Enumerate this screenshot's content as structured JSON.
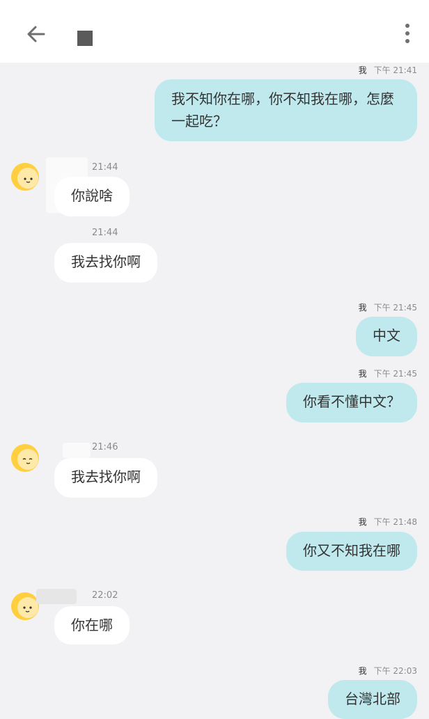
{
  "header": {
    "back_icon": "arrow-left-icon",
    "menu_icon": "more-vertical-icon"
  },
  "colors": {
    "outgoing_bubble": "#c0e9ee",
    "incoming_bubble": "#ffffff",
    "background": "#f2f2f4"
  },
  "messages": [
    {
      "direction": "out",
      "sender": "我",
      "time": "下午 21:41",
      "text": "我不知你在哪，你不知我在哪，怎麼一起吃？"
    },
    {
      "direction": "in",
      "time": "21:44",
      "text": "你說啥"
    },
    {
      "direction": "in",
      "time": "21:44",
      "text": "我去找你啊"
    },
    {
      "direction": "out",
      "sender": "我",
      "time": "下午 21:45",
      "text": "中文"
    },
    {
      "direction": "out",
      "sender": "我",
      "time": "下午 21:45",
      "text": "你看不懂中文？"
    },
    {
      "direction": "in",
      "time": "21:46",
      "text": "我去找你啊"
    },
    {
      "direction": "out",
      "sender": "我",
      "time": "下午 21:48",
      "text": "你又不知我在哪"
    },
    {
      "direction": "in",
      "time": "22:02",
      "text": "你在哪"
    },
    {
      "direction": "out",
      "sender": "我",
      "time": "下午 22:03",
      "text": "台灣北部"
    }
  ]
}
